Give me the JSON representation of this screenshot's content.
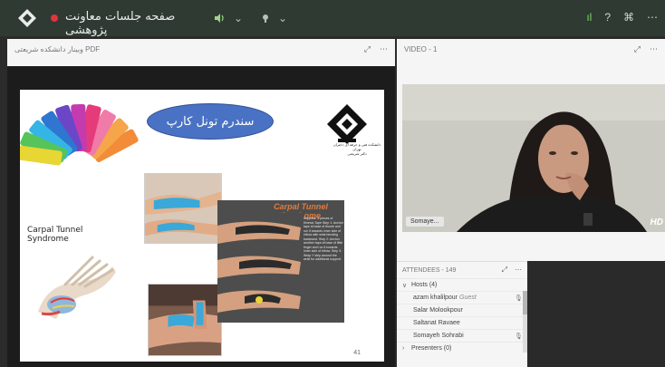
{
  "top_bar": {
    "session_title": "صفحه جلسات معاونت پژوهشی",
    "audio_icon": "speaker-icon",
    "video_icon": "camera-icon",
    "dropdown_glyph": "⌄",
    "signal_glyph": "ıl",
    "help_glyph": "?",
    "layout_glyph": "⌘",
    "more_glyph": "⋯",
    "colors": {
      "bg": "#2f3a33",
      "rec": "#e0353b",
      "audio": "#9fd38a"
    }
  },
  "pdf_panel": {
    "title": "وبینار دانشکده شریعتی PDF",
    "expand_glyph": "⤢",
    "more_glyph": "⋯",
    "slide": {
      "title": "سندرم تونل کارپ",
      "university_caption_line1": "دانشکده فنی و حرفه ای دختران تهران",
      "university_caption_line2": "دکتر شریعتی",
      "left_caption": "Carpal Tunnel Syndrome",
      "panel_heading": "Carpal Tunnel Syndrome",
      "panel_notes": "Supplies: 1 pieces of Kinesio Tape Step 1: Anchor tape at base of thumb and run it towards inner side of elbow with wrist bending backward. Step 2: Anchor another tape at base of little finger and run it towards inner side of elbow. Step 3: Wrap Y strip around the wrist for additional support.",
      "page_number": "41"
    }
  },
  "video_panel": {
    "title": "VIDEO - 1",
    "expand_glyph": "⤢",
    "more_glyph": "⋯",
    "participant_name": "Somaye...",
    "quality_badge": "HD"
  },
  "attendees_panel": {
    "title": "ATTENDEES - 149",
    "expand_glyph": "⤢",
    "more_glyph": "⋯",
    "groups": [
      {
        "chevron": "∨",
        "label": "Hosts (4)"
      },
      {
        "chevron": "›",
        "label": "Presenters (0)"
      }
    ],
    "hosts": [
      {
        "name": "azam khalilpour",
        "role": "Guest",
        "mic": "🎙"
      },
      {
        "name": "Salar Molookpour",
        "role": "",
        "mic": ""
      },
      {
        "name": "Saltanat Ravaee",
        "role": "",
        "mic": ""
      },
      {
        "name": "Somayeh Sohrabi",
        "role": "",
        "mic": "🎙"
      }
    ]
  }
}
